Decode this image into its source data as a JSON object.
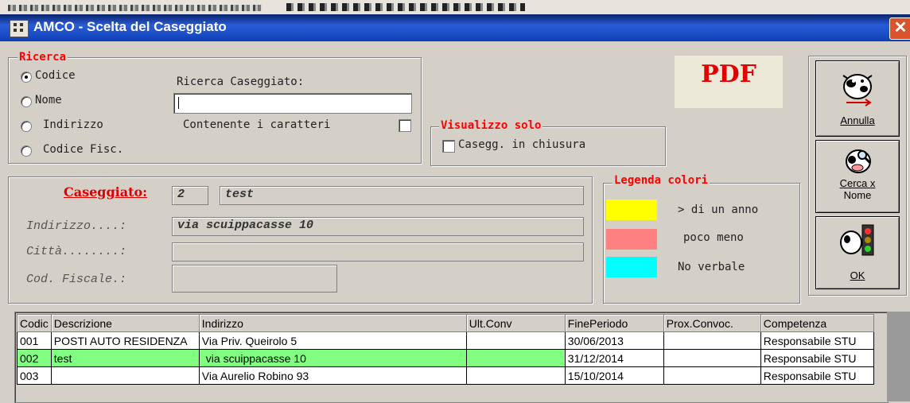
{
  "window": {
    "title": "AMCO - Scelta del Caseggiato",
    "close": "✕"
  },
  "ricerca": {
    "legend": "Ricerca",
    "options": [
      "Codice",
      "Nome",
      "Indirizzo",
      "Codice Fisc."
    ],
    "selected": "Codice",
    "search_label": "Ricerca Caseggiato:",
    "search_value": "",
    "contains_label": "Contenente i caratteri",
    "contains_checked": false
  },
  "visualizzo": {
    "legend": "Visualizzo solo",
    "option_label": "Casegg. in chiusura",
    "checked": false
  },
  "pdf": {
    "label": "PDF"
  },
  "buttons": {
    "annulla": {
      "label": "Annulla",
      "icon": "cow-cancel-icon"
    },
    "cerca_nome": {
      "label1": "Cerca x",
      "label2": "Nome",
      "icon": "cow-search-icon"
    },
    "ok": {
      "label": "OK",
      "icon": "cow-traffic-light-icon"
    }
  },
  "details": {
    "caseggiato_label": "Caseggiato:",
    "codice": "2",
    "nome": "test",
    "indirizzo_label": "Indirizzo....:",
    "indirizzo": "via scuippacasse 10",
    "citta_label": "Città........:",
    "citta": "",
    "cf_label": "Cod. Fiscale.:",
    "cf": ""
  },
  "legenda": {
    "legend": "Legenda colori",
    "items": [
      {
        "color": "#ffff00",
        "label": "> di un anno"
      },
      {
        "color": "#ff8080",
        "label": "poco meno"
      },
      {
        "color": "#00ffff",
        "label": "No verbale"
      }
    ]
  },
  "table": {
    "columns": [
      "Codic",
      "Descrizione",
      "Indirizzo",
      "Ult.Conv",
      "FinePeriodo",
      "Prox.Convoc.",
      "Competenza"
    ],
    "rows": [
      [
        "001",
        "POSTI AUTO RESIDENZA",
        "Via Priv. Queirolo 5",
        "",
        "30/06/2013",
        "",
        "Responsabile STU"
      ],
      [
        "002",
        "test",
        "via scuippacasse 10",
        "",
        "31/12/2014",
        "",
        "Responsabile STU"
      ],
      [
        "003",
        "",
        "Via Aurelio Robino 93",
        "",
        "15/10/2014",
        "",
        "Responsabile STU"
      ]
    ],
    "selected_row": 1,
    "highlight_color": "#80ff80"
  }
}
